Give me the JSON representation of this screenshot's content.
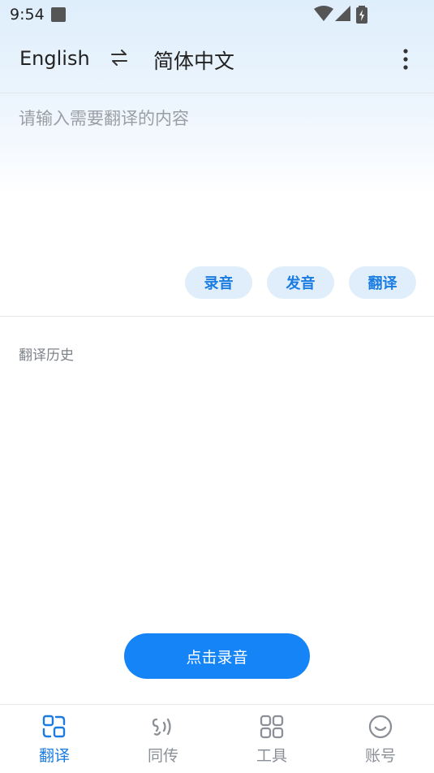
{
  "status_bar": {
    "time": "9:54"
  },
  "language_bar": {
    "source_lang": "English",
    "target_lang": "简体中文"
  },
  "input": {
    "placeholder": "请输入需要翻译的内容"
  },
  "actions": {
    "record_label": "录音",
    "speak_label": "发音",
    "translate_label": "翻译"
  },
  "history": {
    "title": "翻译历史"
  },
  "record_button": {
    "label": "点击录音"
  },
  "bottom_nav": {
    "items": [
      {
        "label": "翻译",
        "icon": "translate-icon",
        "active": true
      },
      {
        "label": "同传",
        "icon": "simultaneous-interpretation-icon",
        "active": false
      },
      {
        "label": "工具",
        "icon": "tools-grid-icon",
        "active": false
      },
      {
        "label": "账号",
        "icon": "account-smile-icon",
        "active": false
      }
    ]
  },
  "colors": {
    "accent": "#1584f7",
    "accent_text": "#1a7ce0",
    "pill_bg": "#e0eefb",
    "inactive_nav": "#8b9096"
  }
}
